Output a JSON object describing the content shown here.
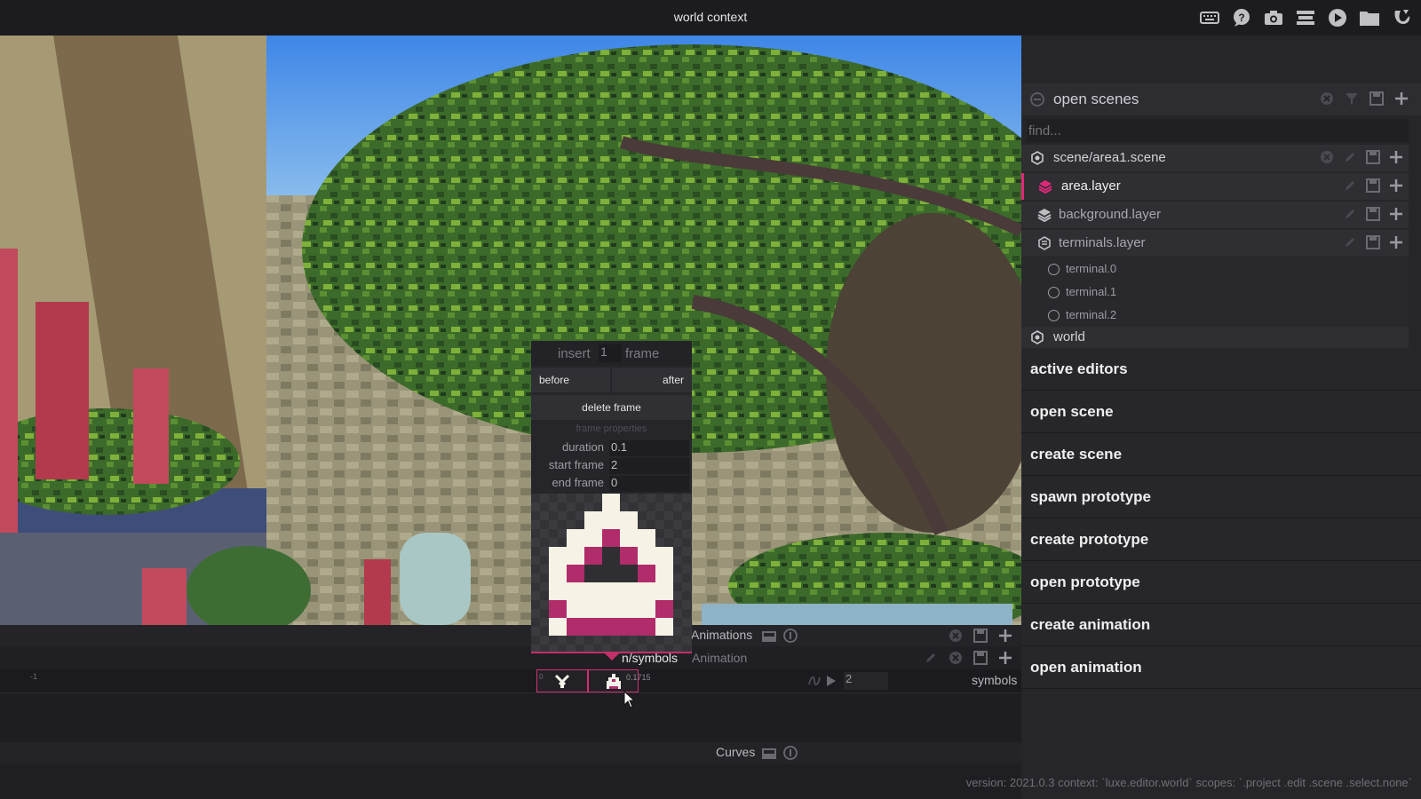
{
  "window": {
    "title": "world context"
  },
  "toolbar_icons": [
    "keyboard-icon",
    "help-icon",
    "camera-icon",
    "stack-icon",
    "play-icon",
    "folder-icon",
    "luxe-logo-icon"
  ],
  "open_scenes": {
    "title": "open scenes",
    "find_placeholder": "find...",
    "tree": [
      {
        "label": "scene/area1.scene",
        "icon": "scene-icon"
      },
      {
        "label": "area.layer",
        "icon": "layer-icon",
        "accent": "#e0287a"
      },
      {
        "label": "background.layer",
        "icon": "layer-icon"
      },
      {
        "label": "terminals.layer",
        "icon": "terminals-layer-icon"
      }
    ],
    "terminals": [
      "terminal.0",
      "terminal.1",
      "terminal.2"
    ],
    "world": "world"
  },
  "commands": [
    "active editors",
    "open scene",
    "create scene",
    "spawn prototype",
    "create prototype",
    "open prototype",
    "create animation",
    "open animation"
  ],
  "animations_bar": {
    "title": "Animations"
  },
  "anim_row": {
    "path": "n/symbols",
    "type": "Animation",
    "right_label": "symbols",
    "frame_field": "2"
  },
  "timeline": {
    "left_tick": "-1",
    "zero_tick": "0",
    "time_label": "0.1715"
  },
  "curves_bar": {
    "title": "Curves"
  },
  "status": {
    "text": "version: 2021.0.3 context: `luxe.editor.world` scopes: `.project .edit .scene .select.none`"
  },
  "popup": {
    "insert_label": "insert",
    "insert_value": "1",
    "frame_label": "frame",
    "before": "before",
    "after": "after",
    "delete": "delete frame",
    "properties_header": "frame properties",
    "duration_label": "duration",
    "duration_value": "0.1",
    "start_label": "start frame",
    "start_value": "2",
    "end_label": "end frame",
    "end_value": "0"
  },
  "colors": {
    "accent": "#d42e72",
    "panel": "#27272b",
    "background": "#1f1f23"
  }
}
